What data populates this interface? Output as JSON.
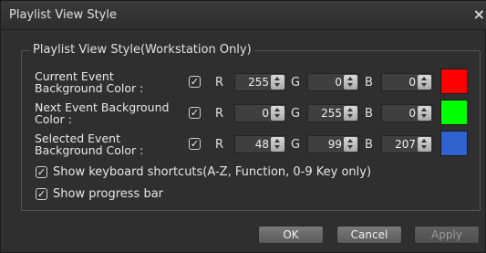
{
  "window": {
    "title": "Playlist View Style",
    "close_glyph": "×"
  },
  "group": {
    "label": "Playlist View Style(Workstation Only)"
  },
  "rows": [
    {
      "label": "Current Event Background Color :",
      "checked": true,
      "r": "255",
      "g": "0",
      "b": "0",
      "swatch": "#ff0000"
    },
    {
      "label": "Next Event Background Color :",
      "checked": true,
      "r": "0",
      "g": "255",
      "b": "0",
      "swatch": "#00ff00"
    },
    {
      "label": "Selected Event Background Color :",
      "checked": true,
      "r": "48",
      "g": "99",
      "b": "207",
      "swatch": "#3063cf"
    }
  ],
  "channels": {
    "r": "R",
    "g": "G",
    "b": "B"
  },
  "options": {
    "keyboard_shortcuts": "Show keyboard shortcuts(A-Z, Function, 0-9 Key only)",
    "progress_bar": "Show progress bar"
  },
  "buttons": {
    "ok": "OK",
    "cancel": "Cancel",
    "apply": "Apply"
  },
  "check_glyph": "✓"
}
